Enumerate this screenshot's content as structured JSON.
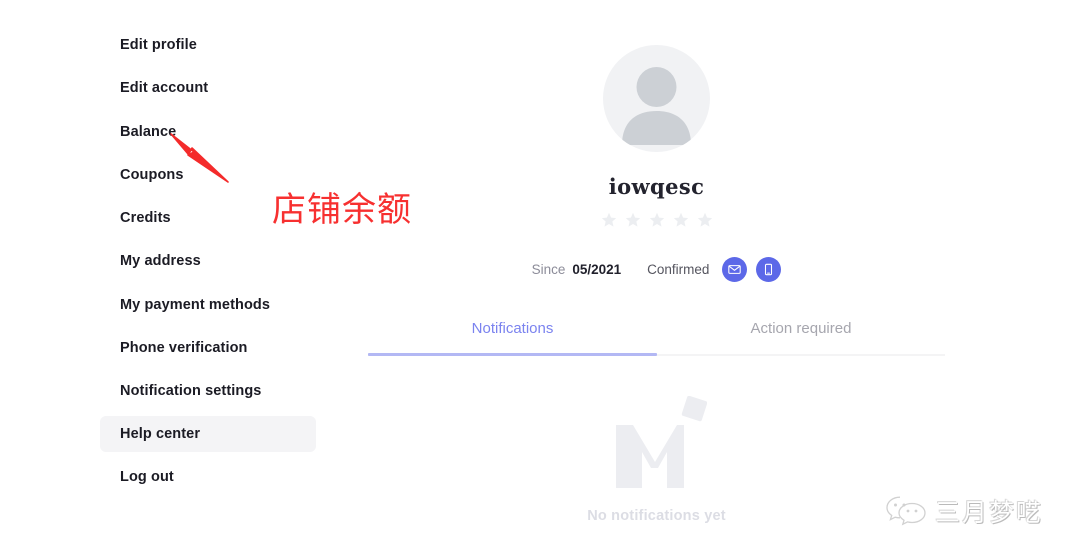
{
  "sidebar": {
    "items": [
      {
        "label": "Edit profile",
        "active": false
      },
      {
        "label": "Edit account",
        "active": false
      },
      {
        "label": "Balance",
        "active": false
      },
      {
        "label": "Coupons",
        "active": false
      },
      {
        "label": "Credits",
        "active": false
      },
      {
        "label": "My address",
        "active": false
      },
      {
        "label": "My payment methods",
        "active": false
      },
      {
        "label": "Phone verification",
        "active": false
      },
      {
        "label": "Notification settings",
        "active": false
      },
      {
        "label": "Help center",
        "active": true
      },
      {
        "label": "Log out",
        "active": false
      }
    ]
  },
  "annotation": {
    "text": "店铺余额",
    "color": "#f73030",
    "arrow_target": "Balance"
  },
  "profile": {
    "avatar_icon": "user-placeholder-icon",
    "username": "iowqesc",
    "rating_stars_total": 5,
    "rating_stars_filled": 0,
    "since_label": "Since",
    "since_value": "05/2021",
    "confirmed_label": "Confirmed",
    "badges": [
      {
        "icon": "email-verified-icon",
        "color": "#5c68e8"
      },
      {
        "icon": "phone-verified-icon",
        "color": "#5c68e8"
      }
    ]
  },
  "tabs": [
    {
      "label": "Notifications",
      "active": true,
      "color": "#7b83ef"
    },
    {
      "label": "Action required",
      "active": false,
      "color": "#a6a6ae"
    }
  ],
  "empty_state": {
    "logo_icon": "m-logo-watermark-icon",
    "message": "No notifications yet"
  },
  "watermark": {
    "icon": "wechat-icon",
    "text": "三月梦呓"
  }
}
